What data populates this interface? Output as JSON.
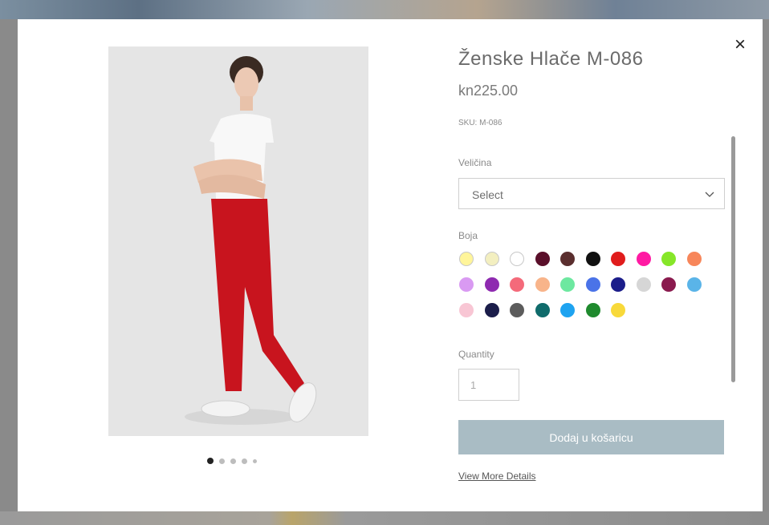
{
  "modal": {
    "close_label": "×",
    "dots": [
      true,
      false,
      false,
      false,
      false
    ]
  },
  "product": {
    "title": "Ženske Hlače M-086",
    "price": "kn225.00",
    "sku": "SKU: M-086",
    "size_label": "Veličina",
    "size_select_value": "Select",
    "color_label": "Boja",
    "colors": [
      "#fff59a",
      "#f3efc0",
      "#ffffff",
      "#5a0f2a",
      "#5a2e2e",
      "#111111",
      "#e01c1c",
      "#ff1aa3",
      "#86e629",
      "#f7865a",
      "#d99af2",
      "#8e2ab0",
      "#f46a7a",
      "#f8b48a",
      "#6de8a0",
      "#4a73e8",
      "#1b1d8a",
      "#d6d6d6",
      "#8a1a4e",
      "#5ab4e8",
      "#f8c6d4",
      "#1b1d4a",
      "#5c5c5c",
      "#0f6b6b",
      "#1ea3f0",
      "#1f8a2e",
      "#f8d93a"
    ],
    "quantity_label": "Quantity",
    "quantity_value": "1",
    "add_to_cart_label": "Dodaj u košaricu",
    "view_details_label": "View More Details"
  },
  "icons": {
    "close": "close-icon",
    "chevron": "chevron-down-icon"
  },
  "theme": {
    "button_color": "#a9bcc4"
  }
}
